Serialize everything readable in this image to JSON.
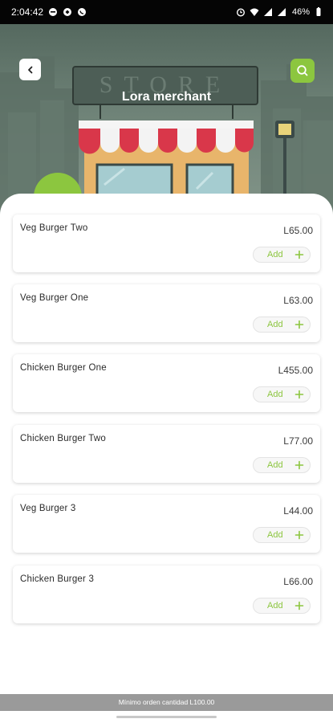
{
  "status_bar": {
    "time": "2:04:42",
    "battery": "46%",
    "left_icons": [
      "chat-icon",
      "sync-icon",
      "whatsapp-icon"
    ],
    "right_icons": [
      "alarm-icon",
      "wifi-icon",
      "signal-icon",
      "signal-icon",
      "battery-icon"
    ]
  },
  "header": {
    "title": "Lora merchant",
    "back_icon": "chevron-left-icon",
    "search_icon": "search-icon",
    "store_sign": "STORE"
  },
  "colors": {
    "accent": "#8cc63f",
    "awning_red": "#d9374a",
    "bottom_bar": "#9a9a9a"
  },
  "products": [
    {
      "name": "Veg Burger Two",
      "price": "L65.00",
      "add_label": "Add"
    },
    {
      "name": "Veg Burger One",
      "price": "L63.00",
      "add_label": "Add"
    },
    {
      "name": "Chicken Burger One",
      "price": "L455.00",
      "add_label": "Add"
    },
    {
      "name": "Chicken Burger Two",
      "price": "L77.00",
      "add_label": "Add"
    },
    {
      "name": "Veg Burger 3",
      "price": "L44.00",
      "add_label": "Add"
    },
    {
      "name": "Chicken Burger 3",
      "price": "L66.00",
      "add_label": "Add"
    }
  ],
  "footer": {
    "minimum_order": "Mínimo orden cantidad L100.00"
  }
}
